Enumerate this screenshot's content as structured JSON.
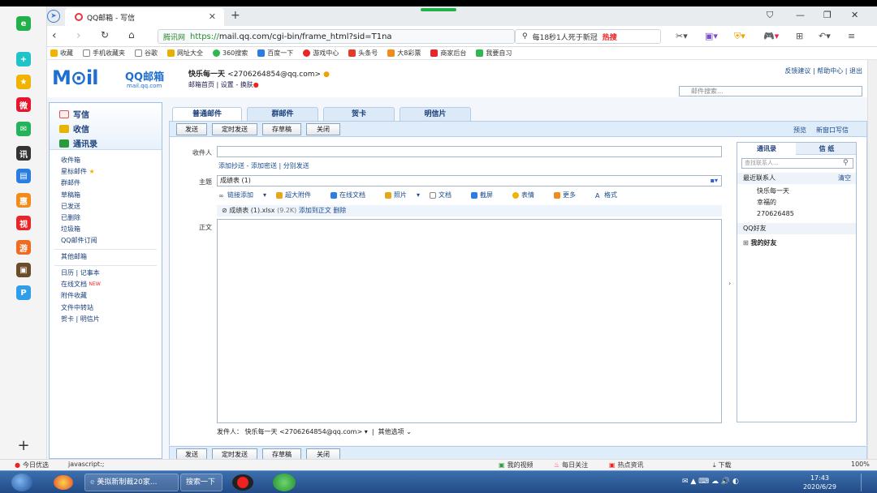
{
  "browser": {
    "tab_title": "QQ邮箱 - 写信",
    "url_site": "腾讯网",
    "url_scheme": "https://",
    "url_rest": "mail.qq.com/cgi-bin/frame_html?sid=T1na",
    "search_text": "每18秒1人死于新冠",
    "search_hot": "热搜",
    "bookmarks": [
      "收藏",
      "手机收藏夹",
      "谷歌",
      "网址大全",
      "360搜索",
      "百度一下",
      "游戏中心",
      "头条号",
      "大8彩票",
      "商家后台",
      "我要自习"
    ]
  },
  "mail": {
    "logo": "M⊙il",
    "logo_sub": "QQ邮箱",
    "logo_domain": "mail.qq.com",
    "user_name": "快乐每一天",
    "user_email": "<2706264854@qq.com>",
    "home_link": "邮箱首页",
    "settings_link": "设置",
    "skin_link": "换肤",
    "top_links": "反馈建议 | 帮助中心 | 退出",
    "search_placeholder": "邮件搜索...",
    "compose": "写信",
    "inbox": "收信",
    "address_book": "通讯录",
    "folders": [
      "收件箱",
      "星标邮件",
      "群邮件",
      "草稿箱",
      "已发送",
      "已删除",
      "垃圾箱",
      "QQ邮件订阅"
    ],
    "other_mail": "其他邮箱",
    "apps_line1": "日历 | 记事本",
    "apps_online_doc": "在线文档",
    "apps_new": "NEW",
    "apps_attach": "附件收藏",
    "apps_transfer": "文件中转站",
    "apps_cards": "贺卡 | 明信片",
    "tabs": [
      "普通邮件",
      "群邮件",
      "贺卡",
      "明信片"
    ],
    "btn_send": "发送",
    "btn_timed": "定时发送",
    "btn_draft": "存草稿",
    "btn_close": "关闭",
    "btn_send_bottom": "发送",
    "preview": "预览",
    "new_window": "新窗口写信",
    "label_to": "收件人",
    "to_links": "添加抄送 - 添加密送 | 分别发送",
    "label_subject": "主题",
    "subject": "成绩表 (1)",
    "tools": [
      "链接添加",
      "超大附件",
      "在线文档",
      "照片",
      "文档",
      "截屏",
      "表情",
      "更多",
      "格式"
    ],
    "attachment_name": "成绩表 (1).xlsx",
    "attachment_size": "(9.2K)",
    "attachment_add": "添加到正文",
    "attachment_delete": "删除",
    "label_body": "正文",
    "sender_label": "发件人：",
    "sender": "快乐每一天 <2706264854@qq.com>",
    "other_options": "其他选项",
    "contacts_tab": "通讯录",
    "stationery_tab": "信 纸",
    "contacts_search": "查找联系人...",
    "recent": "最近联系人",
    "clear": "清空",
    "recent_list": [
      "快乐每一天",
      "幸福的",
      "270626485"
    ],
    "qq_friends": "QQ好友",
    "my_friends": "我的好友"
  },
  "status": {
    "left": "今日优选",
    "js": "javascript:;",
    "items": [
      "我的视频",
      "每日关注",
      "热点资讯",
      "下载"
    ],
    "zoom": "100%"
  },
  "taskbar": {
    "item1": "美拟新制裁20家...",
    "item2": "搜索一下",
    "time": "17:43",
    "date": "2020/6/29"
  },
  "colors": {
    "accent": "#1e6fd0",
    "link": "#1a4a8c",
    "panel_border": "#9dc0e6"
  }
}
